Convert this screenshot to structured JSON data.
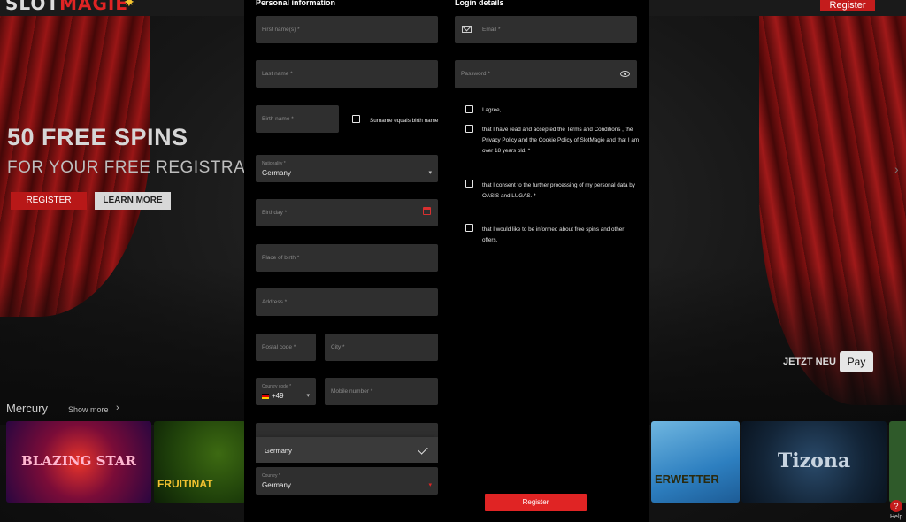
{
  "background": {
    "logo_part1": "SLOT",
    "logo_part2": "MAGIE",
    "top_register": "Register",
    "hero_title": "50 FREE SPINS",
    "hero_subtitle": "FOR YOUR FREE REGISTRATIO",
    "hero_register": "REGISTER",
    "hero_learn_more": "LEARN MORE",
    "jetzt_neu": "JETZT NEU",
    "apple_pay": "Pay",
    "row_title": "Mercury",
    "show_more": "Show more",
    "games": [
      "BLAZING STAR",
      "FRUITINAT",
      "ERWETTER",
      "Tizona"
    ],
    "help": "Help"
  },
  "personal": {
    "title": "Personal information",
    "first_name": "First name(s) *",
    "last_name": "Last name *",
    "birth_name": "Birth name *",
    "surname_equals": "Surname equals birth name",
    "nationality_label": "Nationality *",
    "nationality_value": "Germany",
    "birthday": "Birthday *",
    "place_of_birth": "Place of birth *",
    "address": "Address *",
    "postal_code": "Postal code *",
    "city": "City *",
    "country_code_label": "Country code *",
    "country_code_value": "+49",
    "mobile_number": "Mobile number *",
    "dropdown_option": "Germany",
    "country_label": "Country *",
    "country_value": "Germany"
  },
  "login": {
    "title": "Login details",
    "email": "Email *",
    "password": "Password *",
    "agree": "I agree,",
    "terms": "that I have read and accepted the Terms and Conditions , the Privacy Policy and the Cookie Policy of SlotMagie and that I am over 18 years old. *",
    "consent": "that I consent to the further processing of my personal data by OASIS and LUGAS. *",
    "newsletter": "that I would like to be informed about free spins and other offers."
  },
  "register_button": "Register"
}
